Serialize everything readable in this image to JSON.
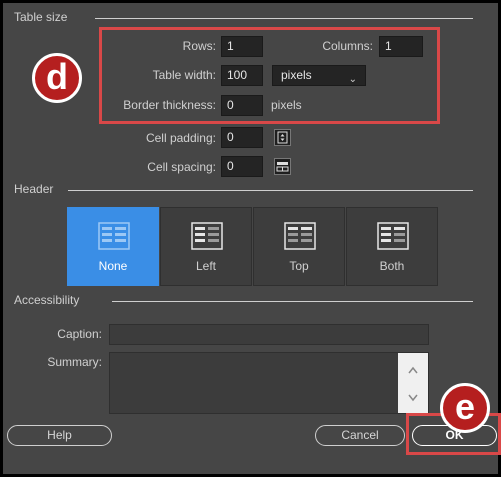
{
  "table_size": {
    "section_title": "Table size",
    "rows_label": "Rows:",
    "rows_value": "1",
    "columns_label": "Columns:",
    "columns_value": "1",
    "width_label": "Table width:",
    "width_value": "100",
    "width_unit": "pixels",
    "border_label": "Border thickness:",
    "border_value": "0",
    "border_unit": "pixels",
    "padding_label": "Cell padding:",
    "padding_value": "0",
    "spacing_label": "Cell spacing:",
    "spacing_value": "0"
  },
  "header": {
    "section_title": "Header",
    "options": [
      {
        "label": "None",
        "selected": true
      },
      {
        "label": "Left",
        "selected": false
      },
      {
        "label": "Top",
        "selected": false
      },
      {
        "label": "Both",
        "selected": false
      }
    ]
  },
  "accessibility": {
    "section_title": "Accessibility",
    "caption_label": "Caption:",
    "caption_value": "",
    "summary_label": "Summary:",
    "summary_value": ""
  },
  "buttons": {
    "help": "Help",
    "cancel": "Cancel",
    "ok": "OK"
  },
  "annotations": {
    "d": "d",
    "e": "e"
  },
  "colors": {
    "selected": "#3a8ee6",
    "highlight": "#d94848",
    "badge": "#b51f1f"
  }
}
